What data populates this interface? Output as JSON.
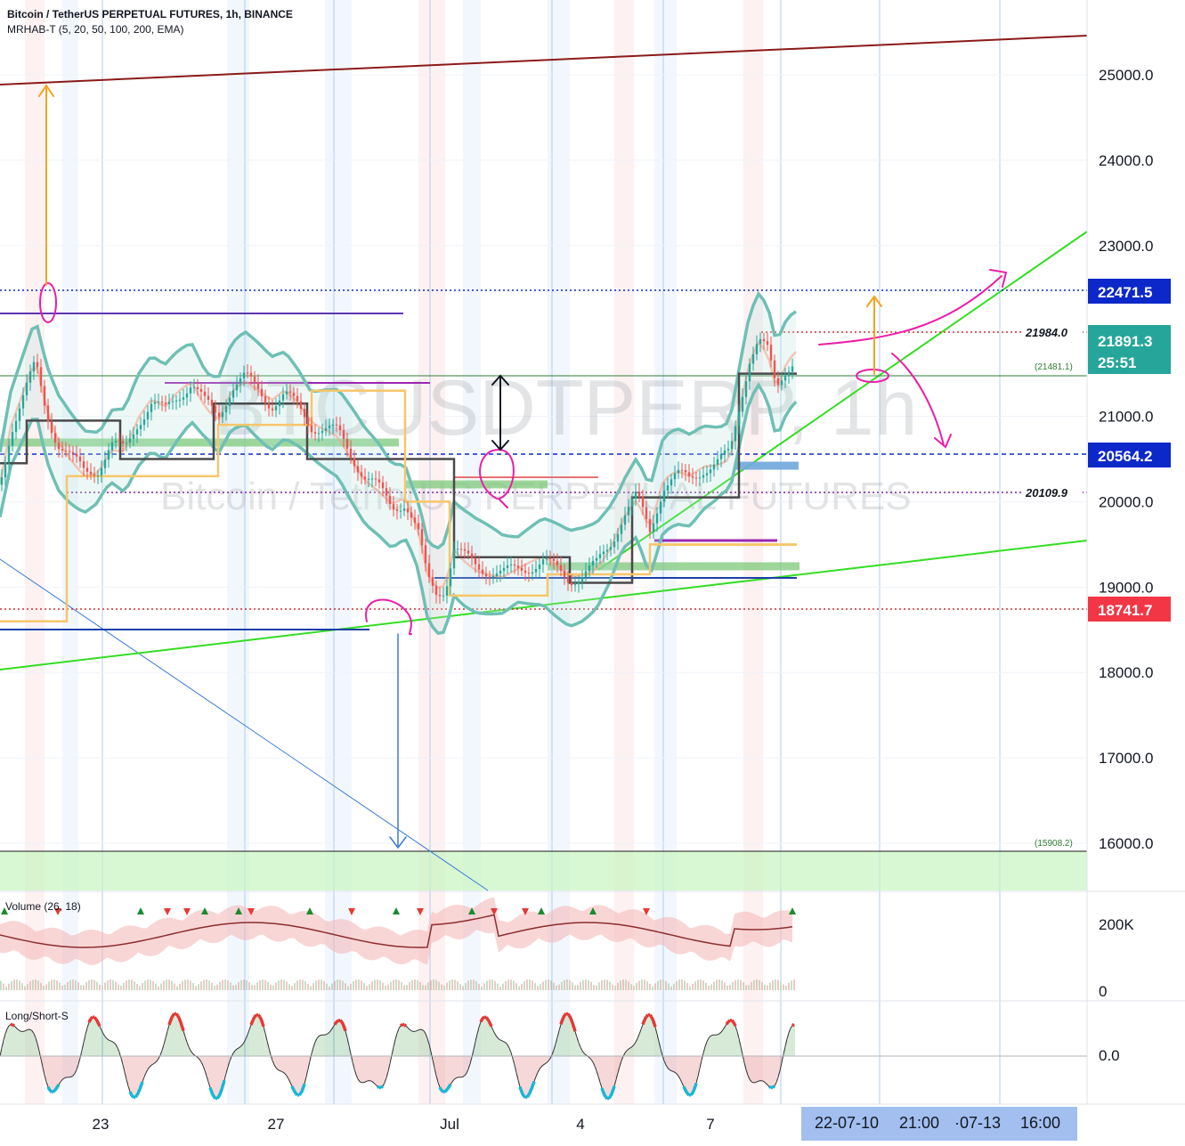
{
  "header": {
    "title": "Bitcoin / TetherUS PERPETUAL FUTURES, 1h, BINANCE",
    "indicator": "MRHAB-T (5, 20, 50, 100, 200, EMA)"
  },
  "watermark": {
    "symbol": "BTCUSDTPERP, 1h",
    "description": "Bitcoin / TetherUS PERPETUAL FUTURES"
  },
  "panes": {
    "volume_label": "Volume (26, 18)",
    "volume_ticks": [
      "200K",
      "0"
    ],
    "oscillator_label": "Long/Short-S",
    "oscillator_ticks": [
      "0.0"
    ]
  },
  "chart_data": {
    "type": "candlestick",
    "symbol": "Bitcoin / TetherUS PERPETUAL FUTURES",
    "interval": "1h",
    "exchange": "BINANCE",
    "y_ticks": [
      25000.0,
      24000.0,
      23000.0,
      21000.0,
      20000.0,
      19000.0,
      18000.0,
      17000.0,
      16000.0
    ],
    "y_tick_labels": [
      "25000.0",
      "24000.0",
      "23000.0",
      "21000.0",
      "20000.0",
      "19000.0",
      "18000.0",
      "17000.0",
      "16000.0"
    ],
    "ylim": [
      15500,
      25450
    ],
    "x_tick_labels": [
      "23",
      "27",
      "Jul",
      "4",
      "7"
    ],
    "price_badges": [
      {
        "value": "22471.5",
        "color": "#0d28c9"
      },
      {
        "value": "21891.3",
        "sub": "25:51",
        "color": "#26a69a"
      },
      {
        "value": "20564.2",
        "color": "#0d28c9"
      },
      {
        "value": "18741.7",
        "color": "#f23645"
      }
    ],
    "level_annotations": [
      {
        "value": 21984.0,
        "label": "21984.0"
      },
      {
        "value": 20109.9,
        "label": "20109.9"
      },
      {
        "value": 21481.1,
        "label": "(21481.1)"
      },
      {
        "value": 15908.2,
        "label": "(15908.2)"
      }
    ],
    "close_path": [
      [
        0,
        20200
      ],
      [
        12,
        20850
      ],
      [
        25,
        21200
      ],
      [
        40,
        21600
      ],
      [
        52,
        21050
      ],
      [
        65,
        20700
      ],
      [
        80,
        20500
      ],
      [
        95,
        20350
      ],
      [
        110,
        20400
      ],
      [
        125,
        20650
      ],
      [
        140,
        20600
      ],
      [
        155,
        20950
      ],
      [
        170,
        21150
      ],
      [
        185,
        21050
      ],
      [
        200,
        21250
      ],
      [
        215,
        21400
      ],
      [
        230,
        21150
      ],
      [
        245,
        21000
      ],
      [
        260,
        21350
      ],
      [
        275,
        21450
      ],
      [
        290,
        21300
      ],
      [
        305,
        21150
      ],
      [
        320,
        21250
      ],
      [
        335,
        21100
      ],
      [
        350,
        20900
      ],
      [
        365,
        20850
      ],
      [
        380,
        20800
      ],
      [
        395,
        20550
      ],
      [
        410,
        20300
      ],
      [
        425,
        20150
      ],
      [
        440,
        19950
      ],
      [
        455,
        20000
      ],
      [
        470,
        19600
      ],
      [
        480,
        19100
      ],
      [
        490,
        18950
      ],
      [
        500,
        19000
      ],
      [
        510,
        19450
      ],
      [
        520,
        19350
      ],
      [
        535,
        19250
      ],
      [
        550,
        19200
      ],
      [
        565,
        19150
      ],
      [
        580,
        19200
      ],
      [
        595,
        19250
      ],
      [
        610,
        19300
      ],
      [
        625,
        19200
      ],
      [
        640,
        19100
      ],
      [
        655,
        19150
      ],
      [
        670,
        19250
      ],
      [
        685,
        19500
      ],
      [
        700,
        19850
      ],
      [
        715,
        20050
      ],
      [
        730,
        19650
      ],
      [
        745,
        20200
      ],
      [
        760,
        20300
      ],
      [
        775,
        20250
      ],
      [
        790,
        20400
      ],
      [
        805,
        20450
      ],
      [
        820,
        20550
      ],
      [
        832,
        21200
      ],
      [
        842,
        21700
      ],
      [
        852,
        21900
      ],
      [
        862,
        21750
      ],
      [
        872,
        21300
      ],
      [
        882,
        21550
      ],
      [
        892,
        21700
      ]
    ],
    "series": [
      {
        "name": "Volume (26, 18)"
      },
      {
        "name": "Long/Short-S"
      }
    ]
  },
  "time_cursor": {
    "segments": [
      "22-07-10",
      "21:00",
      "·07-13",
      "16:00"
    ]
  },
  "colors": {
    "trend_green": "#33dd22",
    "resistance_dark_red": "#8b1a1a",
    "bollinger_teal": "#6fbfb4",
    "annotation_magenta": "#e91ea8",
    "annotation_orange": "#f7a21b",
    "blue_level": "#0d28c9",
    "red_level": "#f23645"
  }
}
